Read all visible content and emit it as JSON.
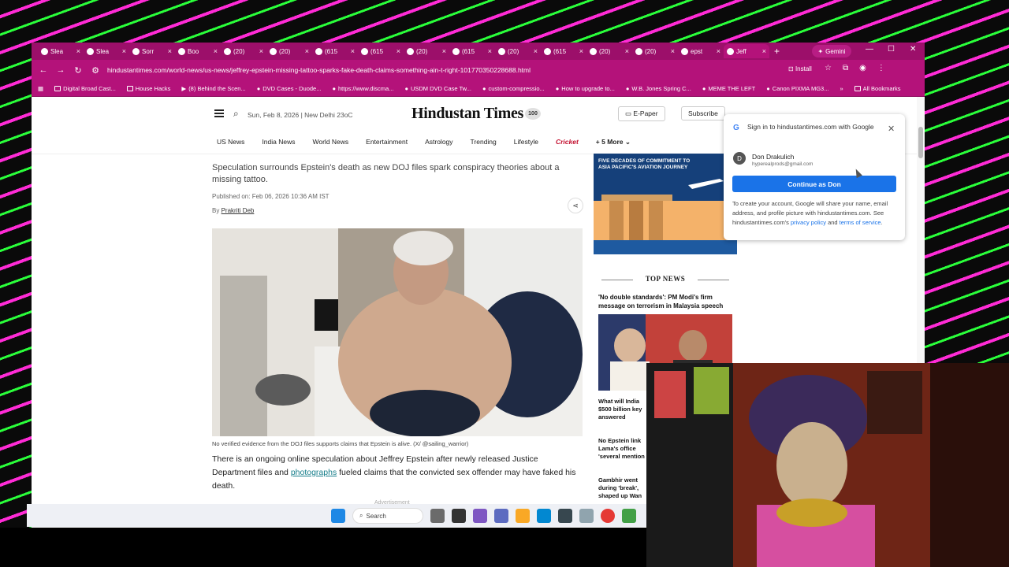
{
  "browser": {
    "tabs": [
      "Slea",
      "Slea",
      "Sorr",
      "Boo",
      "(20)",
      "(20)",
      "(615",
      "(615",
      "(20)",
      "(615",
      "(20)",
      "(615",
      "(20)",
      "(20)",
      "epst",
      "Jeff"
    ],
    "gemini_label": "Gemini",
    "url": "hindustantimes.com/world-news/us-news/jeffrey-epstein-missing-tattoo-sparks-fake-death-claims-something-ain-t-right-101770350228688.html",
    "install_label": "Install",
    "bookmarks": [
      "Digital Broad Cast...",
      "House Hacks",
      "(8) Behind the Scen...",
      "DVD Cases - Duode...",
      "https://www.discma...",
      "USDM DVD Case Tw...",
      "custom-compressio...",
      "How to upgrade to...",
      "W.B. Jones Spring C...",
      "MEME THE LEFT",
      "Canon PIXMA MG3..."
    ],
    "all_bookmarks": "All Bookmarks"
  },
  "site": {
    "dateline": "Sun, Feb 8, 2026  |  New Delhi 23oC",
    "logo": "Hindustan Times",
    "logo_badge": "100",
    "epaper": "E-Paper",
    "subscribe": "Subscribe",
    "nav": [
      "US News",
      "India News",
      "World News",
      "Entertainment",
      "Astrology",
      "Trending",
      "Lifestyle"
    ],
    "cricket": "Cricket",
    "more": "+ 5 More"
  },
  "article": {
    "subhead": "Speculation surrounds Epstein's death as new DOJ files spark conspiracy theories about a missing tattoo.",
    "published": "Published on: Feb 06, 2026 10:36 AM IST",
    "by": "By",
    "author": "Prakriti Deb",
    "caption": "No verified evidence from the DOJ files supports claims that Epstein is alive. (X/ @sailing_warrior)",
    "body_1": "There is an ongoing online speculation about Jeffrey Epstein after newly released Justice Department files and ",
    "body_link": "photographs",
    "body_2": " fueled claims that the convicted sex offender may have faked his death.",
    "advert": "Advertisement"
  },
  "sidebar": {
    "ad_title": "FIVE DECADES OF COMMITMENT TO ASIA PACIFIC'S AVIATION JOURNEY",
    "top_news_heading": "TOP NEWS",
    "first_story": "'No double standards': PM Modi's firm message on terrorism in Malaysia speech",
    "stories": [
      "What will India $500 billion key answered",
      "No Epstein link Lama's office 'several mention",
      "Gambhir went during 'break', shaped up Wan"
    ]
  },
  "google_popup": {
    "title": "Sign in to hindustantimes.com with Google",
    "avatar_letter": "D",
    "name": "Don Drakulich",
    "email": "hyperealprods@gmail.com",
    "button": "Continue as Don",
    "info_1": "To create your account, Google will share your name, email address, and profile picture with hindustantimes.com. See hindustantimes.com's ",
    "privacy": "privacy policy",
    "and": " and ",
    "terms": "terms of service",
    "period": "."
  },
  "taskbar": {
    "search": "Search"
  }
}
